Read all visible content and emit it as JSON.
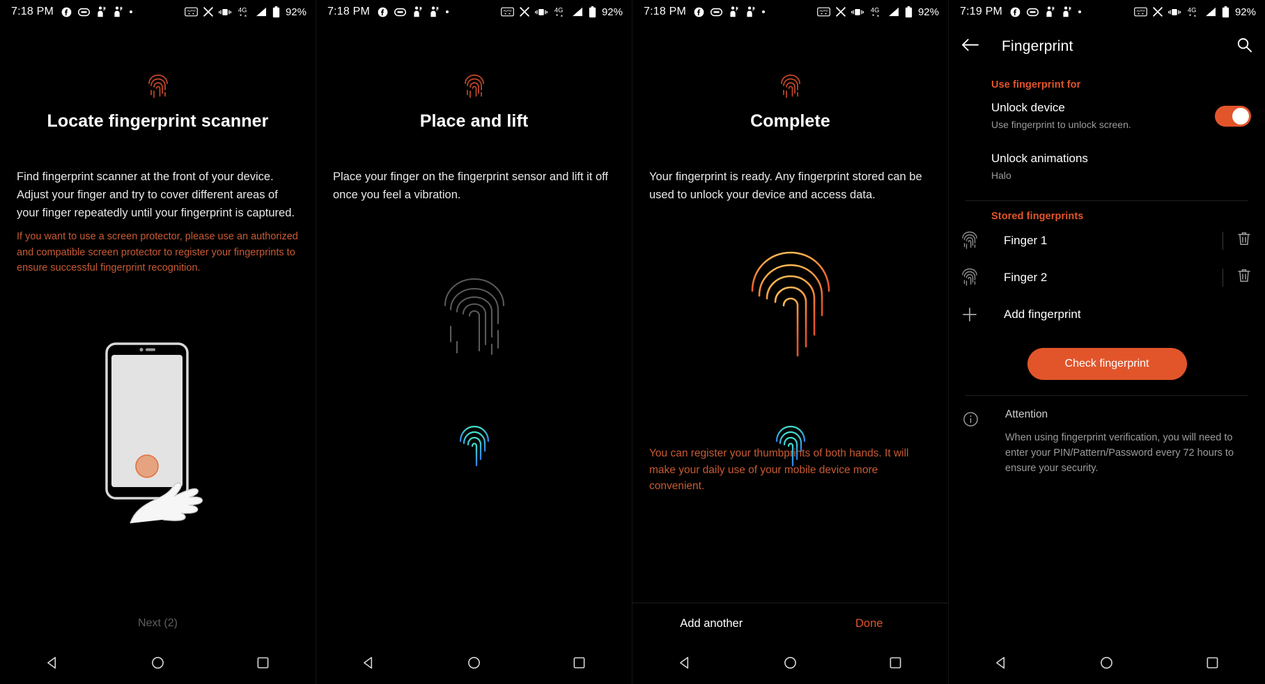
{
  "statusbars": [
    {
      "time": "7:18 PM",
      "battery": "92%",
      "network": "4G",
      "icons": [
        "facebook-icon",
        "messages-icon",
        "person-icon",
        "person-icon",
        "dot-icon"
      ],
      "right_icons": [
        "auto-rotate-icon",
        "x-app-icon",
        "vibrate-icon",
        "signal-icon",
        "battery-icon"
      ]
    },
    {
      "time": "7:18 PM",
      "battery": "92%",
      "network": "4G",
      "icons": [
        "facebook-icon",
        "messages-icon",
        "person-icon",
        "person-icon",
        "dot-icon"
      ],
      "right_icons": [
        "auto-rotate-icon",
        "x-app-icon",
        "vibrate-icon",
        "signal-icon",
        "battery-icon"
      ]
    },
    {
      "time": "7:18 PM",
      "battery": "92%",
      "network": "4G",
      "icons": [
        "facebook-icon",
        "messages-icon",
        "person-icon",
        "person-icon",
        "dot-icon"
      ],
      "right_icons": [
        "auto-rotate-icon",
        "x-app-icon",
        "vibrate-icon",
        "signal-icon",
        "battery-icon"
      ]
    },
    {
      "time": "7:19 PM",
      "battery": "92%",
      "network": "4G",
      "icons": [
        "facebook-icon",
        "messages-icon",
        "person-icon",
        "person-icon",
        "dot-icon"
      ],
      "right_icons": [
        "auto-rotate-icon",
        "x-app-icon",
        "vibrate-icon",
        "signal-icon",
        "battery-icon"
      ]
    }
  ],
  "panel1": {
    "title": "Locate fingerprint scanner",
    "body": "Find fingerprint scanner at the front of your device. Adjust your finger and try to cover different areas of your finger repeatedly until your fingerprint is captured.",
    "warning": "If you want to use a screen protector, please use an authorized and compatible screen protector to register your fingerprints to ensure successful fingerprint recognition.",
    "next_label": "Next (2)"
  },
  "panel2": {
    "title": "Place and lift",
    "body": "Place your finger on the fingerprint sensor and lift it off once you feel a vibration."
  },
  "panel3": {
    "title": "Complete",
    "body": "Your fingerprint is ready. Any fingerprint stored can be used to unlock your device and access data.",
    "warning": "You can register your thumbprints of both hands. It will make your daily use of your mobile device more convenient.",
    "add_another_label": "Add another",
    "done_label": "Done"
  },
  "settings": {
    "appbar": {
      "title": "Fingerprint",
      "back_icon": "back-arrow-icon",
      "search_icon": "search-icon"
    },
    "section_use": "Use fingerprint for",
    "unlock_device": {
      "title": "Unlock device",
      "subtitle": "Use fingerprint to unlock screen.",
      "toggle_on": true
    },
    "unlock_animations": {
      "title": "Unlock animations",
      "subtitle": "Halo"
    },
    "section_stored": "Stored fingerprints",
    "fingerprints": [
      {
        "name": "Finger 1",
        "icon": "fingerprint-icon",
        "delete_icon": "trash-icon"
      },
      {
        "name": "Finger 2",
        "icon": "fingerprint-icon",
        "delete_icon": "trash-icon"
      }
    ],
    "add_fingerprint": {
      "label": "Add fingerprint",
      "icon": "plus-icon"
    },
    "check_button": "Check fingerprint",
    "attention": {
      "icon": "info-icon",
      "title": "Attention",
      "text": "When using fingerprint verification, you will need to enter your PIN/Pattern/Password every 72 hours to ensure your security."
    }
  },
  "navbar": {
    "back": "nav-back-icon",
    "home": "nav-home-icon",
    "recents": "nav-recents-icon"
  },
  "colors": {
    "accent": "#e2552b",
    "warning_text": "#c85a33",
    "background": "#000000",
    "text_primary": "#ffffff",
    "text_secondary": "#9b9b9b"
  }
}
